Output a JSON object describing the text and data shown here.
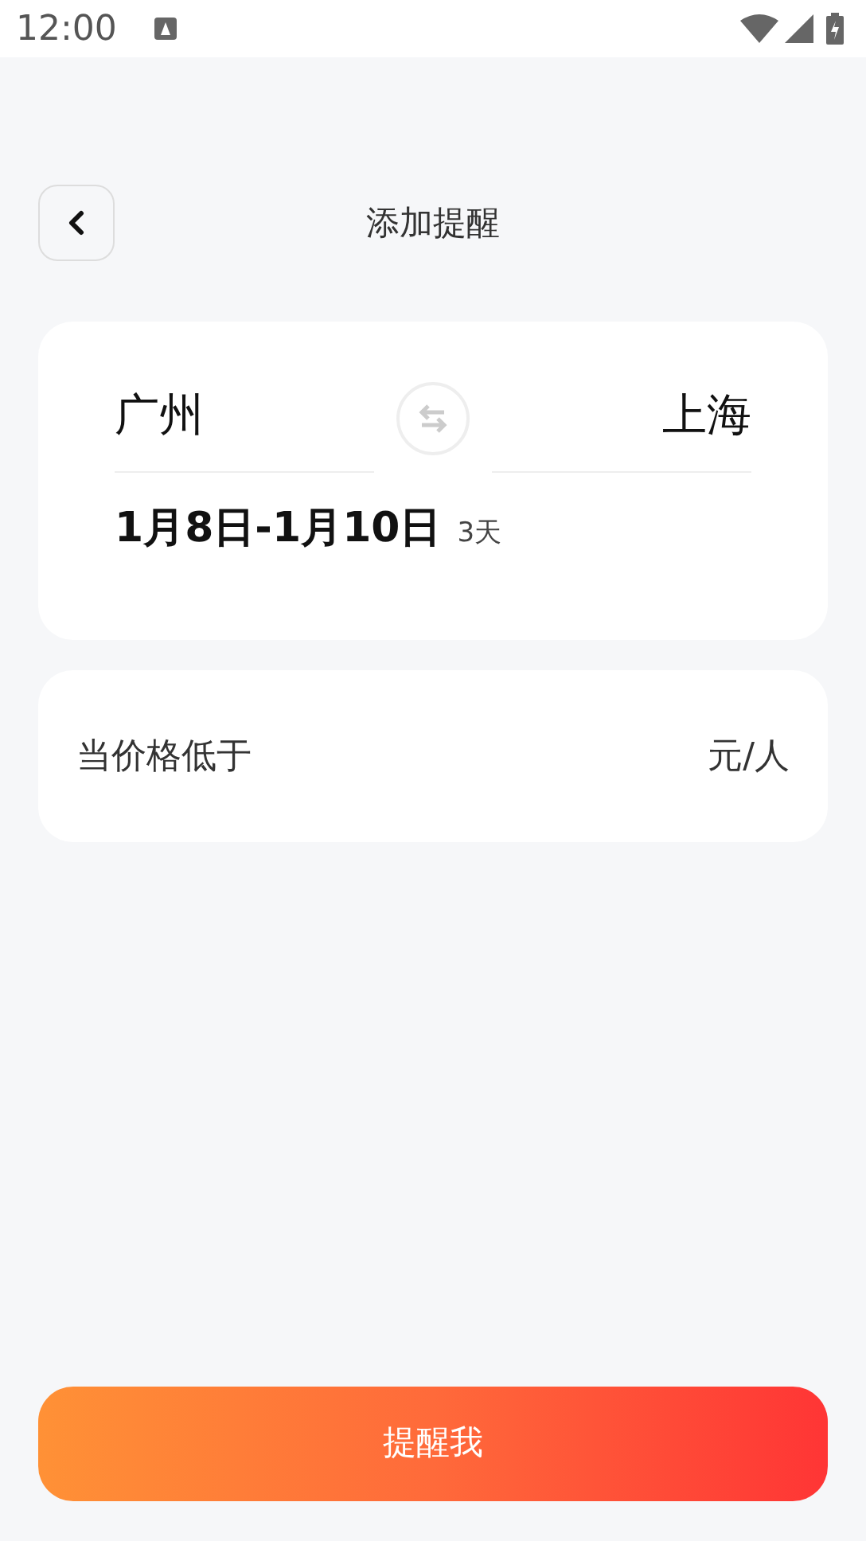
{
  "status_bar": {
    "time": "12:00"
  },
  "header": {
    "title": "添加提醒"
  },
  "route": {
    "from": "广州",
    "to": "上海",
    "dates": "1月8日-1月10日",
    "duration": "3天"
  },
  "price_alert": {
    "label": "当价格低于",
    "unit": "元/人"
  },
  "submit": {
    "label": "提醒我"
  }
}
